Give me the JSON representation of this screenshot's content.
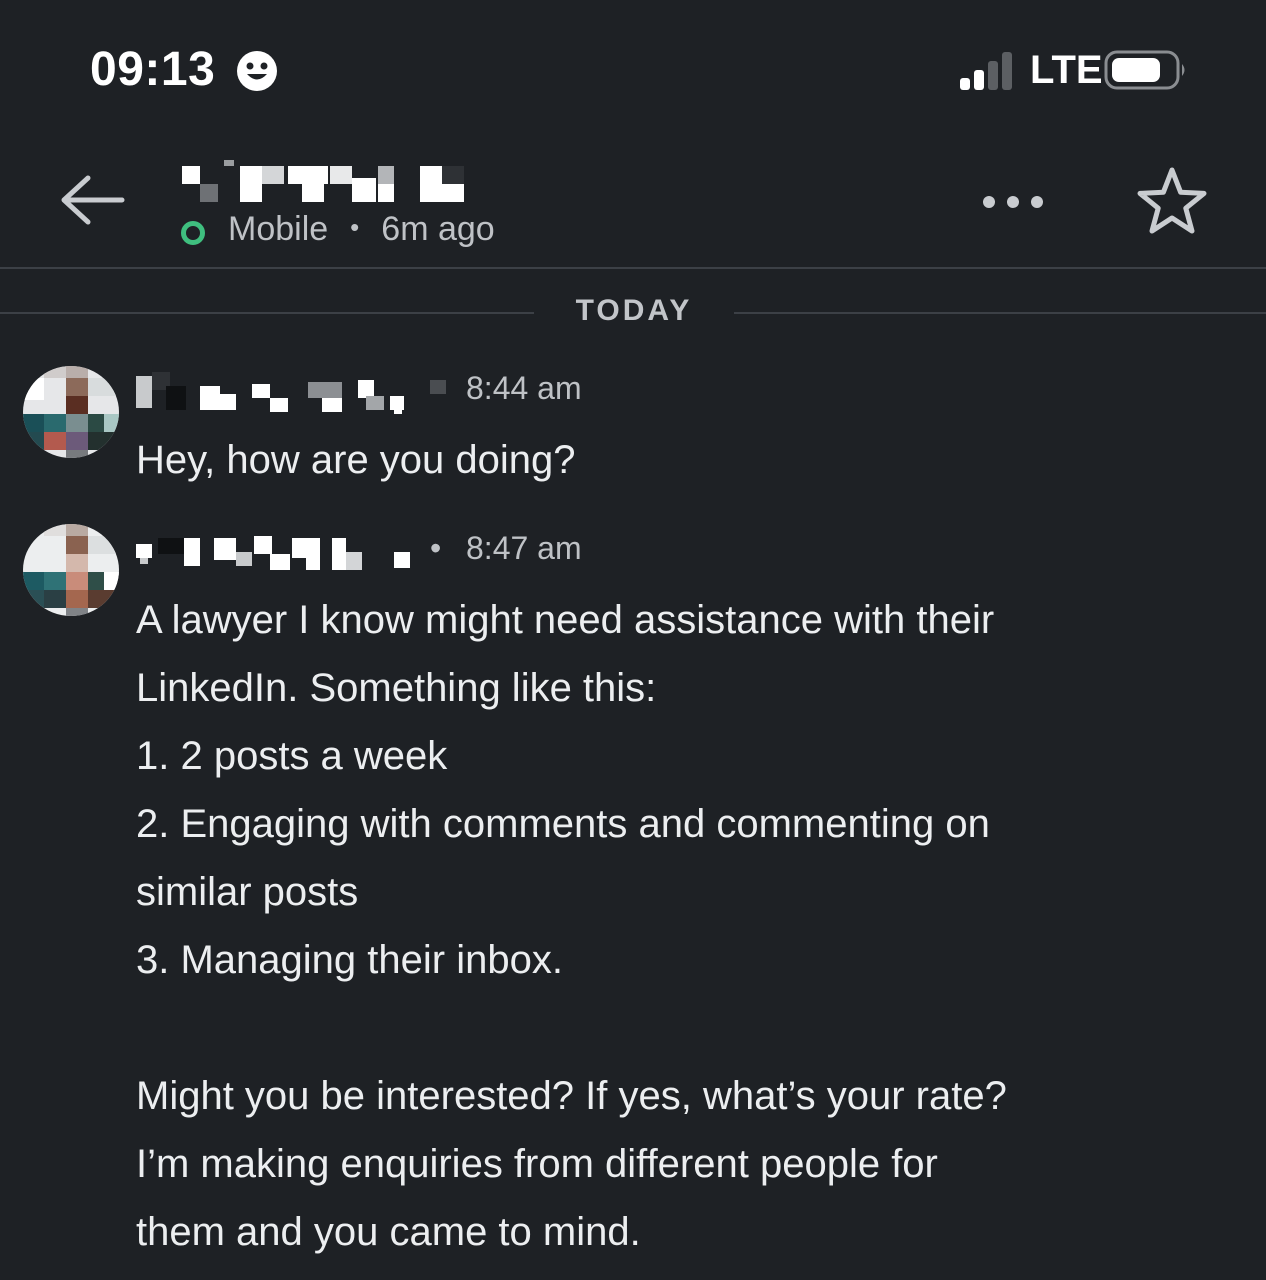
{
  "status_bar": {
    "time": "09:13",
    "network": "LTE"
  },
  "header": {
    "presence_device": "Mobile",
    "presence_separator": "•",
    "presence_last_seen": "6m ago"
  },
  "divider": {
    "label": "TODAY"
  },
  "messages": [
    {
      "timestamp": "8:44 am",
      "text": "Hey, how are you doing?"
    },
    {
      "timestamp": "8:47 am",
      "separator": "•",
      "text": "A lawyer I know might need assistance with their\nLinkedIn. Something like this:\n1. 2 posts a week\n2. Engaging with comments and commenting on\nsimilar posts\n3. Managing their inbox.\n\nMight you be interested? If yes, what’s your rate?\nI’m making enquiries from different people for\nthem and you came to mind."
    }
  ],
  "colors": {
    "background": "#1e2125",
    "online_green": "#3fbf7f",
    "text": "#eceef0",
    "muted": "#bfc2c6"
  }
}
